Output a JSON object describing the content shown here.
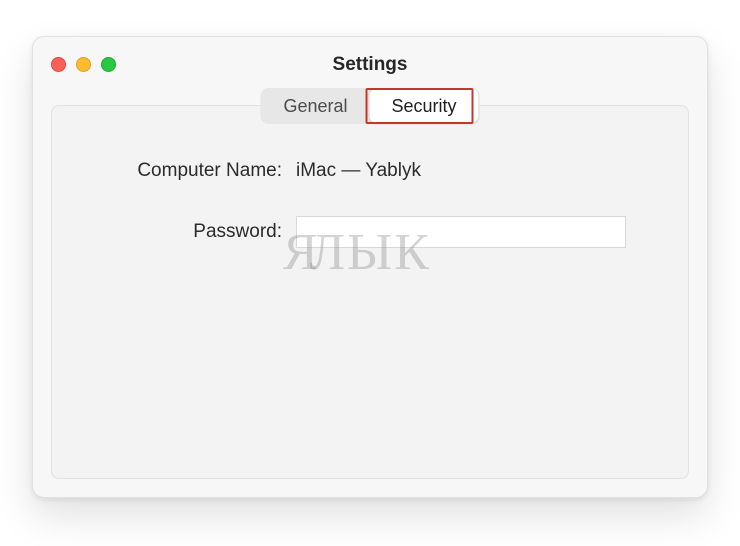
{
  "window": {
    "title": "Settings"
  },
  "tabs": {
    "general": "General",
    "security": "Security",
    "active": "security"
  },
  "fields": {
    "computer_name_label": "Computer Name:",
    "computer_name_value": "iMac — Yablyk",
    "password_label": "Password:",
    "password_value": ""
  },
  "watermark": {
    "text_left": "Я",
    "text_right": "ЛЫК",
    "apple_glyph": ""
  },
  "colors": {
    "highlight": "#c0392b"
  }
}
